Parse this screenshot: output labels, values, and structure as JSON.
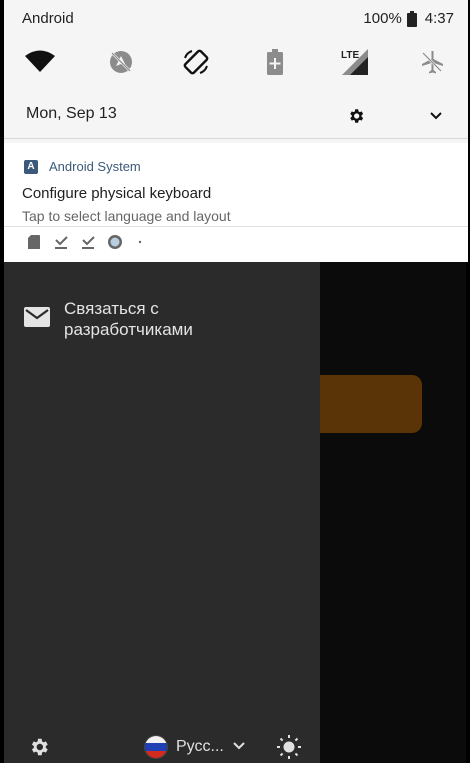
{
  "status_bar": {
    "carrier": "Android",
    "battery": "100%",
    "time": "4:37"
  },
  "quick_settings": {
    "tiles": [
      {
        "name": "wifi-icon"
      },
      {
        "name": "location-off-icon"
      },
      {
        "name": "auto-rotate-icon"
      },
      {
        "name": "battery-saver-icon"
      },
      {
        "name": "mobile-data-icon",
        "label": "LTE"
      },
      {
        "name": "airplane-mode-icon"
      }
    ]
  },
  "header": {
    "date": "Mon, Sep 13"
  },
  "notification": {
    "app_name": "Android System",
    "app_initial": "A",
    "title": "Configure physical keyboard",
    "text": "Tap to select language and layout",
    "icons": [
      "sd-card-icon",
      "download-done-icon",
      "download-done-icon",
      "sync-icon",
      "dot-icon"
    ]
  },
  "drawer": {
    "contact_label": "Связаться с разработчиками",
    "language_label": "Русс..."
  },
  "colors": {
    "shade_bg": "#f5f5f5",
    "drawer_bg": "#2b2b2b",
    "accent": "#3b5a7a",
    "orange_button": "#5a3406"
  }
}
